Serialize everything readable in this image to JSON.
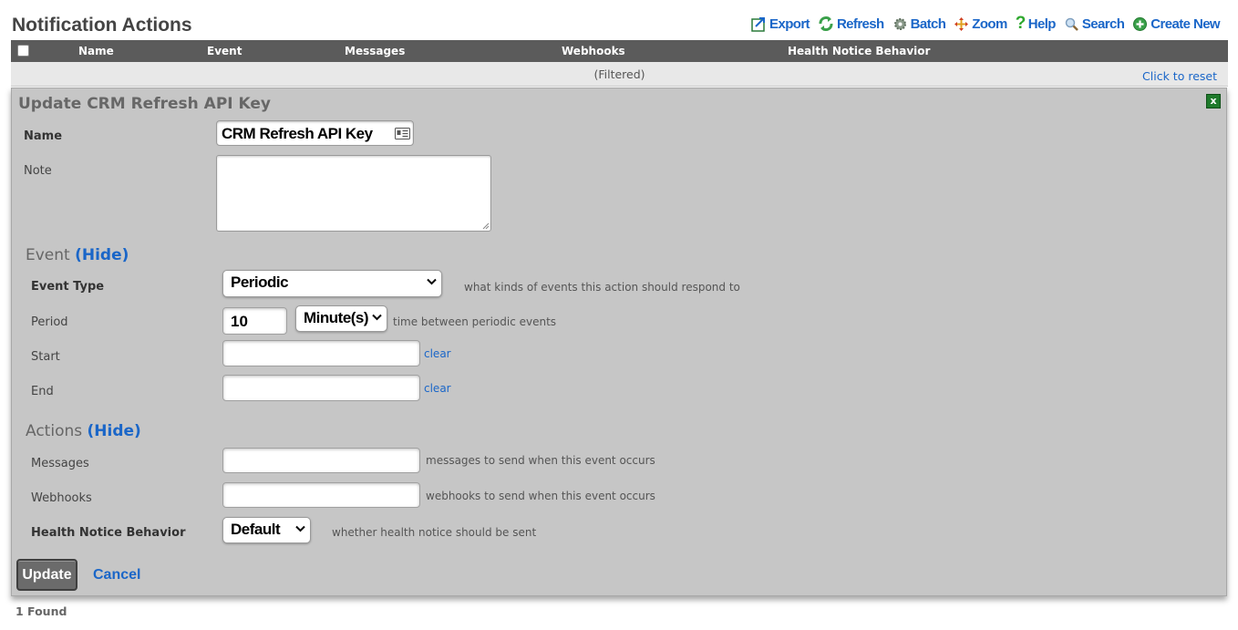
{
  "page": {
    "title": "Notification Actions"
  },
  "toolbar": {
    "items": [
      {
        "label": "Export",
        "icon": "export-icon"
      },
      {
        "label": "Refresh",
        "icon": "refresh-icon"
      },
      {
        "label": "Batch",
        "icon": "gear-icon"
      },
      {
        "label": "Zoom",
        "icon": "zoom-arrows-icon"
      },
      {
        "label": "Help",
        "icon": "help-icon"
      },
      {
        "label": "Search",
        "icon": "search-icon"
      },
      {
        "label": "Create New",
        "icon": "plus-circle-icon"
      }
    ]
  },
  "grid": {
    "columns": [
      "Name",
      "Event",
      "Messages",
      "Webhooks",
      "Health Notice Behavior"
    ],
    "filtered_text": "(Filtered)",
    "reset_text": "Click to reset",
    "found_text": "1 Found"
  },
  "form": {
    "title": "Update CRM Refresh API Key",
    "close_label": "x",
    "name_label": "Name",
    "name_value": "CRM Refresh API Key",
    "note_label": "Note",
    "note_value": "",
    "event_section": {
      "title": "Event",
      "toggle": "(Hide)"
    },
    "event_type_label": "Event Type",
    "event_type_value": "Periodic",
    "event_type_hint": "what kinds of events this action should respond to",
    "period_label": "Period",
    "period_value": "10",
    "period_unit": "Minute(s)",
    "period_hint": "time between periodic events",
    "start_label": "Start",
    "start_value": "",
    "end_label": "End",
    "end_value": "",
    "clear_label": "clear",
    "actions_section": {
      "title": "Actions",
      "toggle": "(Hide)"
    },
    "messages_label": "Messages",
    "messages_value": "",
    "messages_hint": "messages to send when this event occurs",
    "webhooks_label": "Webhooks",
    "webhooks_value": "",
    "webhooks_hint": "webhooks to send when this event occurs",
    "health_label": "Health Notice Behavior",
    "health_value": "Default",
    "health_hint": "whether health notice should be sent",
    "update_label": "Update",
    "cancel_label": "Cancel"
  },
  "colors": {
    "link": "#1a66c8",
    "header_bg": "#5b5b5b",
    "panel_bg": "#c6c6c6",
    "close_green": "#1e7a2b"
  }
}
